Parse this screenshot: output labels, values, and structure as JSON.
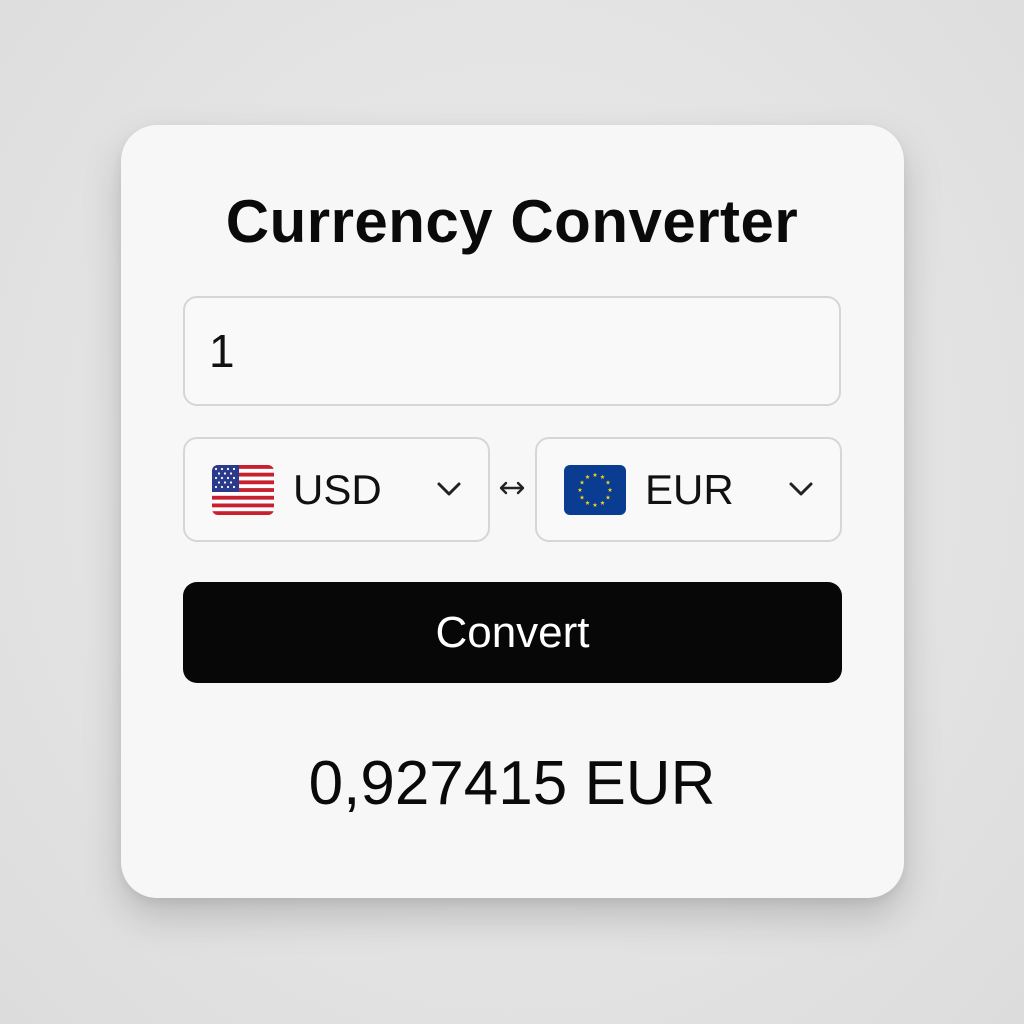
{
  "converter": {
    "title": "Currency Converter",
    "amount": {
      "value": "1"
    },
    "from": {
      "code": "USD",
      "flag_icon": "us-flag-icon"
    },
    "to": {
      "code": "EUR",
      "flag_icon": "eu-flag-icon"
    },
    "swap_icon": "swap-arrows-icon",
    "convert_label": "Convert",
    "result": "0,927415 EUR"
  },
  "colors": {
    "button_background": "#070707",
    "button_text": "#ffffff",
    "card_background": "#f7f7f7",
    "border": "#d6d6d6",
    "eu_blue": "#0a3d91",
    "eu_star": "#f7d117"
  }
}
